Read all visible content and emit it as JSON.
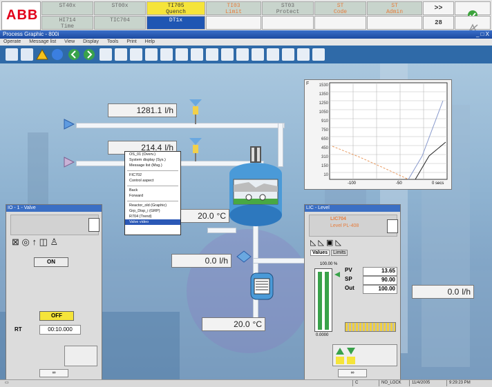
{
  "alarm_bar": {
    "row1": [
      "ST40x",
      "ST00x",
      "TI705\nQuench",
      "TI03\nLimit",
      "ST03\nProtect",
      "ST\nCode",
      "ST\nAdmin"
    ],
    "row2": [
      "HI714\nTime",
      "TIC704",
      "DT1x",
      "",
      "",
      "",
      ""
    ],
    "more_label": ">>",
    "count": "28"
  },
  "window": {
    "title": "Process Graphic - 800i"
  },
  "menu": [
    "Operate",
    "Message list",
    "View",
    "Display",
    "Tools",
    "Print",
    "Help"
  ],
  "flows": {
    "top": {
      "value": "1281.1",
      "unit": "l/h"
    },
    "mid": {
      "value": "214.4",
      "unit": "l/h"
    },
    "right_outlet": {
      "value": "0.0",
      "unit": "l/h"
    },
    "right_panel": {
      "value": "0.0",
      "unit": "l/h"
    }
  },
  "temps": {
    "reactor": {
      "value": "20.0",
      "unit": "°C"
    },
    "lower": {
      "value": "20.0",
      "unit": "°C"
    }
  },
  "context_menu": {
    "items": [
      "OS_01 (Overv.)",
      "System display (Sys.)",
      "Message list (Msg.)",
      "FIC702",
      "Control aspect",
      "Back",
      "Forward",
      "Reactor_old (Graphic)",
      "Grp_Disp_i (GRP)",
      "R704 (Trend)",
      "Valve video"
    ],
    "selected": "Valve video"
  },
  "trend": {
    "label": "F",
    "y_ticks": [
      "1530",
      "1350",
      "1250",
      "1050",
      "910",
      "750",
      "650",
      "450",
      "310",
      "150",
      "10"
    ],
    "x_ticks": [
      "-100",
      "-50",
      "0 secs"
    ]
  },
  "left_face": {
    "title": "IO - 1 - Valve",
    "on_label": "ON",
    "off_label": "OFF",
    "rt_label": "RT",
    "rt_value": "00:10.000"
  },
  "right_face": {
    "title": "LIC - Level",
    "tag": "LIC704",
    "desc": "Level PL-408",
    "tabs": [
      "Values",
      "Limits"
    ],
    "bar_percent": "100.00 %",
    "bar_min": "0.0000",
    "rows": [
      {
        "label": "PV",
        "value": "13.65"
      },
      {
        "label": "SP",
        "value": "90.00"
      },
      {
        "label": "Out",
        "value": "100.00"
      }
    ]
  },
  "status_bar": {
    "field1": "C",
    "field2": "NO_LOCK",
    "date": "11/4/2005",
    "time": "9:29:23 PM"
  },
  "colors": {
    "abb_red": "#e2001a",
    "alarm_yellow": "#f5e43a",
    "alarm_blue": "#1f56b3",
    "title_blue": "#2b58b6"
  }
}
